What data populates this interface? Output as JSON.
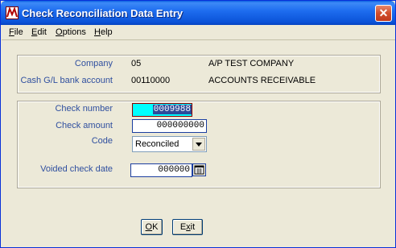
{
  "window": {
    "title": "Check Reconciliation Data Entry",
    "close_glyph": "✕"
  },
  "menu": {
    "file": {
      "mnemonic": "F",
      "rest": "ile"
    },
    "edit": {
      "mnemonic": "E",
      "rest": "dit"
    },
    "options": {
      "mnemonic": "O",
      "rest": "ptions"
    },
    "help": {
      "mnemonic": "H",
      "rest": "elp"
    }
  },
  "info": {
    "company_label": "Company",
    "company_code": "05",
    "company_name": "A/P TEST COMPANY",
    "bank_label": "Cash G/L bank account",
    "bank_account": "00110000",
    "bank_name": "ACCOUNTS RECEIVABLE"
  },
  "form": {
    "check_number_label": "Check number",
    "check_number_value": "0009988",
    "check_amount_label": "Check amount",
    "check_amount_value": "000000000",
    "code_label": "Code",
    "code_value": "Reconciled",
    "voided_date_label": "Voided check date",
    "voided_date_value": "000000"
  },
  "buttons": {
    "ok": {
      "mnemonic": "O",
      "rest": "K"
    },
    "exit": {
      "pre": "E",
      "mnemonic": "x",
      "rest": "it"
    }
  },
  "icons": {
    "app": "app-logo-icon",
    "close": "close-icon",
    "dropdown": "chevron-down-icon",
    "calendar": "calendar-icon"
  },
  "colors": {
    "title_bar": "#0a52d8",
    "label_text": "#2f4f9f",
    "focus_field": "#00ffff"
  }
}
